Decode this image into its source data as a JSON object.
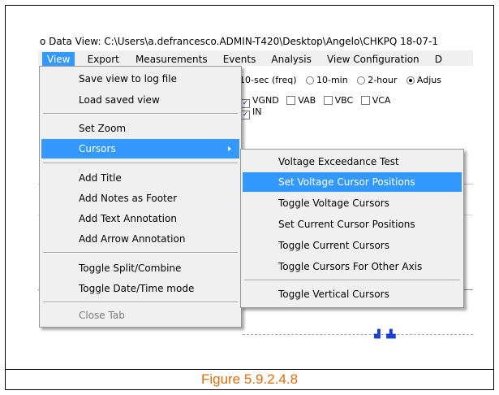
{
  "window": {
    "title": "o Data View: C:\\Users\\a.defrancesco.ADMIN-T420\\Desktop\\Angelo\\CHKPQ 18-07-1"
  },
  "menubar": {
    "items": [
      "View",
      "Export",
      "Measurements",
      "Events",
      "Analysis",
      "View Configuration",
      "D"
    ]
  },
  "background": {
    "interval_options": [
      "10-sec (freq)",
      "10-min",
      "2-hour",
      "Adjus"
    ],
    "channels": [
      "VGND",
      "VAB",
      "VBC",
      "VCA"
    ],
    "channel_in": "IN",
    "channel_check_mark": "✓"
  },
  "view_menu": {
    "items": [
      "Save view to log file",
      "Load saved view",
      "Set Zoom",
      "Cursors",
      "Add Title",
      "Add Notes as Footer",
      "Add Text Annotation",
      "Add Arrow Annotation",
      "Toggle Split/Combine",
      "Toggle Date/Time mode",
      "Close Tab"
    ],
    "highlighted": "Cursors",
    "disabled": "Close Tab"
  },
  "cursors_submenu": {
    "items": [
      "Voltage Exceedance Test",
      "Set Voltage Cursor Positions",
      "Toggle Voltage Cursors",
      "Set Current Cursor Positions",
      "Toggle Current Cursors",
      "Toggle Cursors For Other Axis",
      "Toggle Vertical Cursors"
    ],
    "highlighted": "Set Voltage Cursor Positions"
  },
  "caption": "Figure 5.9.2.4.8",
  "colors": {
    "highlight": "#3399ff",
    "caption": "#e36c09",
    "menu_bg": "#f0f0f0"
  }
}
